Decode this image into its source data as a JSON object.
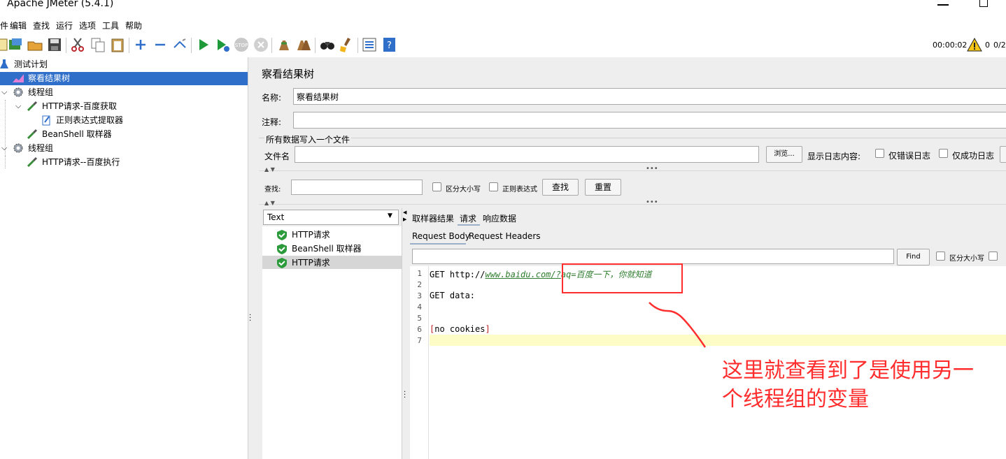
{
  "window": {
    "title": "Apache JMeter (5.4.1)"
  },
  "menu": [
    "件",
    "编辑",
    "查找",
    "运行",
    "选项",
    "工具",
    "帮助"
  ],
  "toolbar": {
    "timer": "00:00:02",
    "warn_count": "0",
    "threads": "0/2"
  },
  "tree": {
    "items": [
      {
        "label": "测试计划"
      },
      {
        "label": "察看结果树"
      },
      {
        "label": "线程组"
      },
      {
        "label": "HTTP请求-百度获取"
      },
      {
        "label": "正则表达式提取器"
      },
      {
        "label": "BeanShell 取样器"
      },
      {
        "label": "线程组"
      },
      {
        "label": "HTTP请求--百度执行"
      }
    ]
  },
  "panel": {
    "title": "察看结果树",
    "name_label": "名称:",
    "name_value": "察看结果树",
    "comment_label": "注释:",
    "comment_value": "",
    "file_group_label": "所有数据写入一个文件",
    "file_label": "文件名",
    "file_value": "",
    "browse_label": "浏览...",
    "log_label": "显示日志内容:",
    "errors_only_label": "仅错误日志",
    "success_only_label": "仅成功日志"
  },
  "search": {
    "label": "查找:",
    "value": "",
    "case_label": "区分大小写",
    "regex_label": "正则表达式",
    "find_button": "查找",
    "reset_button": "重置"
  },
  "results": {
    "renderer": "Text",
    "items": [
      {
        "label": "HTTP请求"
      },
      {
        "label": "BeanShell 取样器"
      },
      {
        "label": "HTTP请求"
      }
    ]
  },
  "tabs": {
    "main": [
      "取样器结果",
      "请求",
      "响应数据"
    ],
    "sub": [
      "Request Body",
      "Request Headers"
    ]
  },
  "request_find": {
    "value": "",
    "find_label": "Find",
    "case_label": "区分大小写"
  },
  "code": {
    "line_numbers": [
      "1",
      "2",
      "3",
      "4",
      "5",
      "6",
      "7"
    ],
    "line1_prefix": "GET http://",
    "line1_link": "www.baidu.com/?",
    "line1_param": "aq=百度一下，你就知道",
    "line3": "GET data:",
    "line6_open": "[",
    "line6_text": "no cookies",
    "line6_close": "]"
  },
  "annotation": {
    "line1": "这里就查看到了是使用另一",
    "line2": "个线程组的变量",
    "color": "#ff2d2d"
  }
}
